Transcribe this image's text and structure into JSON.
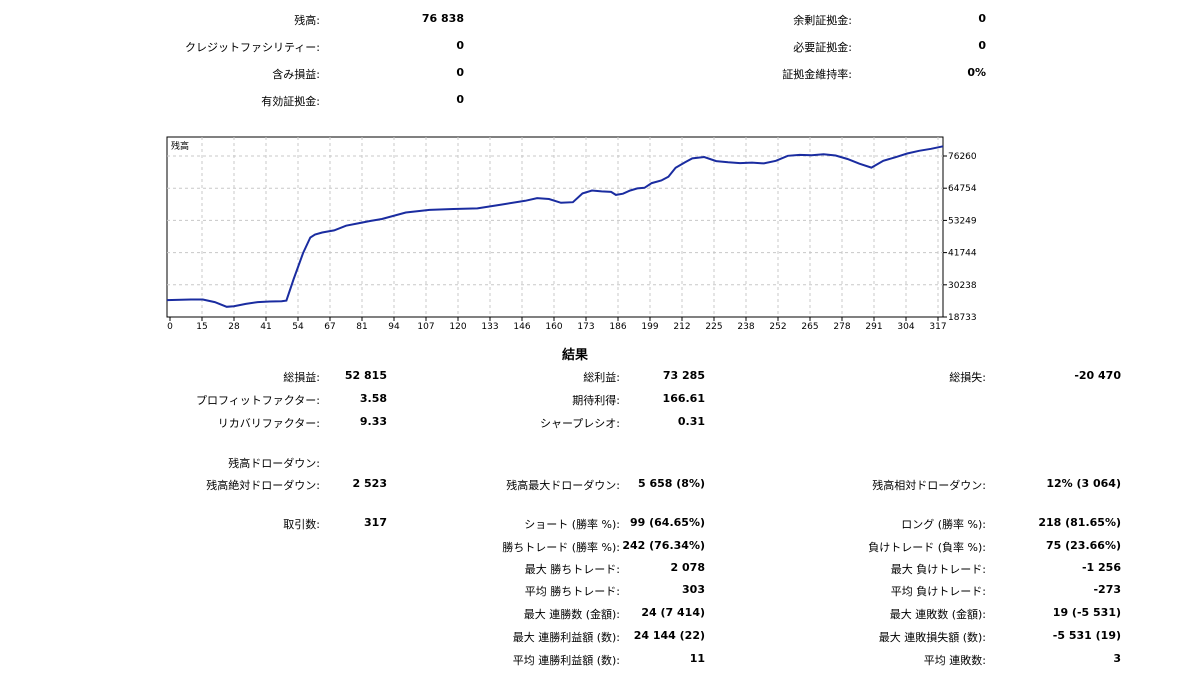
{
  "account": {
    "balance_label": "残高:",
    "balance_value": "76 838",
    "credit_label": "クレジットファシリティー:",
    "credit_value": "0",
    "floating_label": "含み損益:",
    "floating_value": "0",
    "equity_label": "有効証拠金:",
    "equity_value": "0",
    "free_margin_label": "余剰証拠金:",
    "free_margin_value": "0",
    "margin_label": "必要証拠金:",
    "margin_value": "0",
    "margin_level_label": "証拠金維持率:",
    "margin_level_value": "0%"
  },
  "chart_data": {
    "type": "line",
    "title": "残高",
    "line_color": "#1a2ca0",
    "grid": true,
    "x_ticks": [
      "0",
      "15",
      "28",
      "41",
      "54",
      "67",
      "81",
      "94",
      "107",
      "120",
      "133",
      "146",
      "160",
      "173",
      "186",
      "199",
      "212",
      "225",
      "238",
      "252",
      "265",
      "278",
      "291",
      "304",
      "317"
    ],
    "y_ticks": [
      "76260",
      "64754",
      "53249",
      "41744",
      "30238",
      "18733"
    ],
    "xlim": [
      0,
      325
    ],
    "ylim": [
      18733,
      80000
    ],
    "series": [
      {
        "x": [
          0,
          6,
          10,
          15,
          20,
          25,
          28,
          33,
          38,
          43,
          48,
          50,
          53,
          57,
          60,
          62,
          65,
          67,
          70,
          75,
          80,
          85,
          90,
          100,
          110,
          120,
          130,
          140,
          150,
          155,
          160,
          165,
          170,
          174,
          178,
          182,
          186,
          188,
          191,
          194,
          197,
          200,
          203,
          207,
          210,
          213,
          217,
          220,
          225,
          230,
          235,
          240,
          245,
          250,
          255,
          260,
          265,
          270,
          275,
          280,
          285,
          290,
          295,
          300,
          305,
          310,
          315,
          320,
          325
        ],
        "y": [
          24500,
          24600,
          24700,
          24700,
          23800,
          22200,
          22400,
          23200,
          23800,
          24000,
          24100,
          24300,
          31500,
          40500,
          45800,
          46800,
          47500,
          47800,
          48200,
          49800,
          50600,
          51400,
          52100,
          54300,
          55200,
          55500,
          55700,
          57000,
          58300,
          59200,
          58900,
          57600,
          57800,
          60800,
          61800,
          61500,
          61300,
          60300,
          60700,
          61800,
          62500,
          62700,
          64300,
          65200,
          66500,
          69500,
          71400,
          72700,
          73200,
          71800,
          71400,
          71100,
          71300,
          71000,
          71900,
          73600,
          73900,
          73800,
          74100,
          73700,
          72500,
          70900,
          69600,
          71900,
          73100,
          74400,
          75300,
          76000,
          76838
        ]
      }
    ]
  },
  "results": {
    "heading": "結果",
    "rows": [
      {
        "c1": [
          "総損益:",
          "52 815"
        ],
        "c2": [
          "総利益:",
          "73 285"
        ],
        "c3": [
          "総損失:",
          "-20 470"
        ]
      },
      {
        "c1": [
          "プロフィットファクター:",
          "3.58"
        ],
        "c2": [
          "期待利得:",
          "166.61"
        ],
        "c3": [
          "",
          ""
        ]
      },
      {
        "c1": [
          "リカバリファクター:",
          "9.33"
        ],
        "c2": [
          "シャープレシオ:",
          "0.31"
        ],
        "c3": [
          "",
          ""
        ]
      },
      {
        "c1": [
          "残高ドローダウン:",
          ""
        ],
        "c2": [
          "",
          ""
        ],
        "c3": [
          "",
          ""
        ]
      },
      {
        "c1": [
          "残高絶対ドローダウン:",
          "2 523"
        ],
        "c2": [
          "残高最大ドローダウン:",
          "5 658 (8%)"
        ],
        "c3": [
          "残高相対ドローダウン:",
          "12% (3 064)"
        ]
      },
      {
        "c1": [
          "取引数:",
          "317"
        ],
        "c2": [
          "ショート (勝率 %):",
          "99 (64.65%)"
        ],
        "c3": [
          "ロング (勝率 %):",
          "218 (81.65%)"
        ]
      },
      {
        "c1": [
          "",
          ""
        ],
        "c2": [
          "勝ちトレード (勝率 %):",
          "242 (76.34%)"
        ],
        "c3": [
          "負けトレード (負率 %):",
          "75 (23.66%)"
        ]
      },
      {
        "c1": [
          "",
          ""
        ],
        "c2": [
          "最大 勝ちトレード:",
          "2 078"
        ],
        "c3": [
          "最大 負けトレード:",
          "-1 256"
        ]
      },
      {
        "c1": [
          "",
          ""
        ],
        "c2": [
          "平均 勝ちトレード:",
          "303"
        ],
        "c3": [
          "平均 負けトレード:",
          "-273"
        ]
      },
      {
        "c1": [
          "",
          ""
        ],
        "c2": [
          "最大 連勝数 (金額):",
          "24 (7 414)"
        ],
        "c3": [
          "最大 連敗数 (金額):",
          "19 (-5 531)"
        ]
      },
      {
        "c1": [
          "",
          ""
        ],
        "c2": [
          "最大 連勝利益額 (数):",
          "24 144 (22)"
        ],
        "c3": [
          "最大 連敗損失額 (数):",
          "-5 531 (19)"
        ]
      },
      {
        "c1": [
          "",
          ""
        ],
        "c2": [
          "平均 連勝利益額 (数):",
          "11"
        ],
        "c3": [
          "平均 連敗数:",
          "3"
        ]
      }
    ]
  }
}
